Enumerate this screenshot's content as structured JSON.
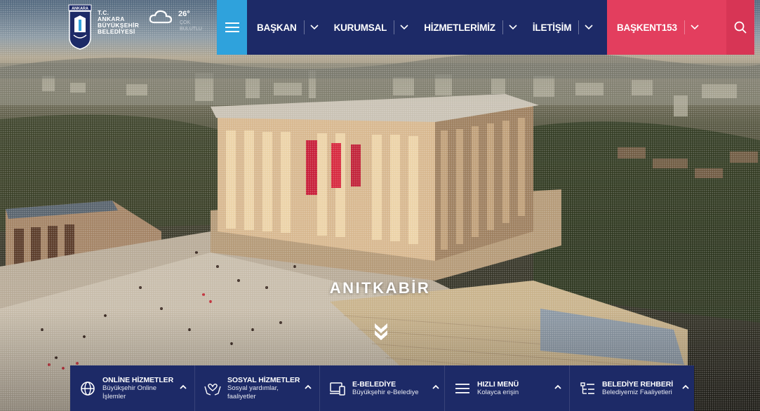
{
  "logo": {
    "badge": "ANKARA",
    "lines": [
      "T.C.",
      "ANKARA",
      "BÜYÜKŞEHİR",
      "BELEDİYESİ"
    ]
  },
  "weather": {
    "icon": "cloud-icon",
    "temp": "26°",
    "desc": "ÇOK BULUTLU"
  },
  "nav": {
    "menu_icon": "hamburger-icon",
    "items": [
      {
        "label": "BAŞKAN"
      },
      {
        "label": "KURUMSAL"
      },
      {
        "label": "HİZMETLERİMİZ"
      },
      {
        "label": "İLETİŞİM"
      }
    ],
    "accent": {
      "label": "BAŞKENT153"
    },
    "search_icon": "search-icon"
  },
  "hero": {
    "title": "ANITKABİR",
    "scroll_icon": "double-chevron-down-icon"
  },
  "services": [
    {
      "icon": "globe-icon",
      "title": "ONLİNE HİZMETLER",
      "sub": "Büyükşehir Online İşlemler"
    },
    {
      "icon": "heart-hands-icon",
      "title": "SOSYAL HİZMETLER",
      "sub": "Sosyal yardımlar, faaliyetler"
    },
    {
      "icon": "devices-icon",
      "title": "E-BELEDİYE",
      "sub": "Büyükşehir e-Belediye"
    },
    {
      "icon": "menu-lines-icon",
      "title": "HIZLI MENÜ",
      "sub": "Kolayca erişin"
    },
    {
      "icon": "directory-icon",
      "title": "BELEDİYE REHBERİ",
      "sub": "Belediyemiz Faaliyetleri"
    }
  ],
  "colors": {
    "nav_dark": "#1d2a67",
    "nav_blue": "#2fa2dc",
    "nav_accent": "#e33e5e"
  }
}
